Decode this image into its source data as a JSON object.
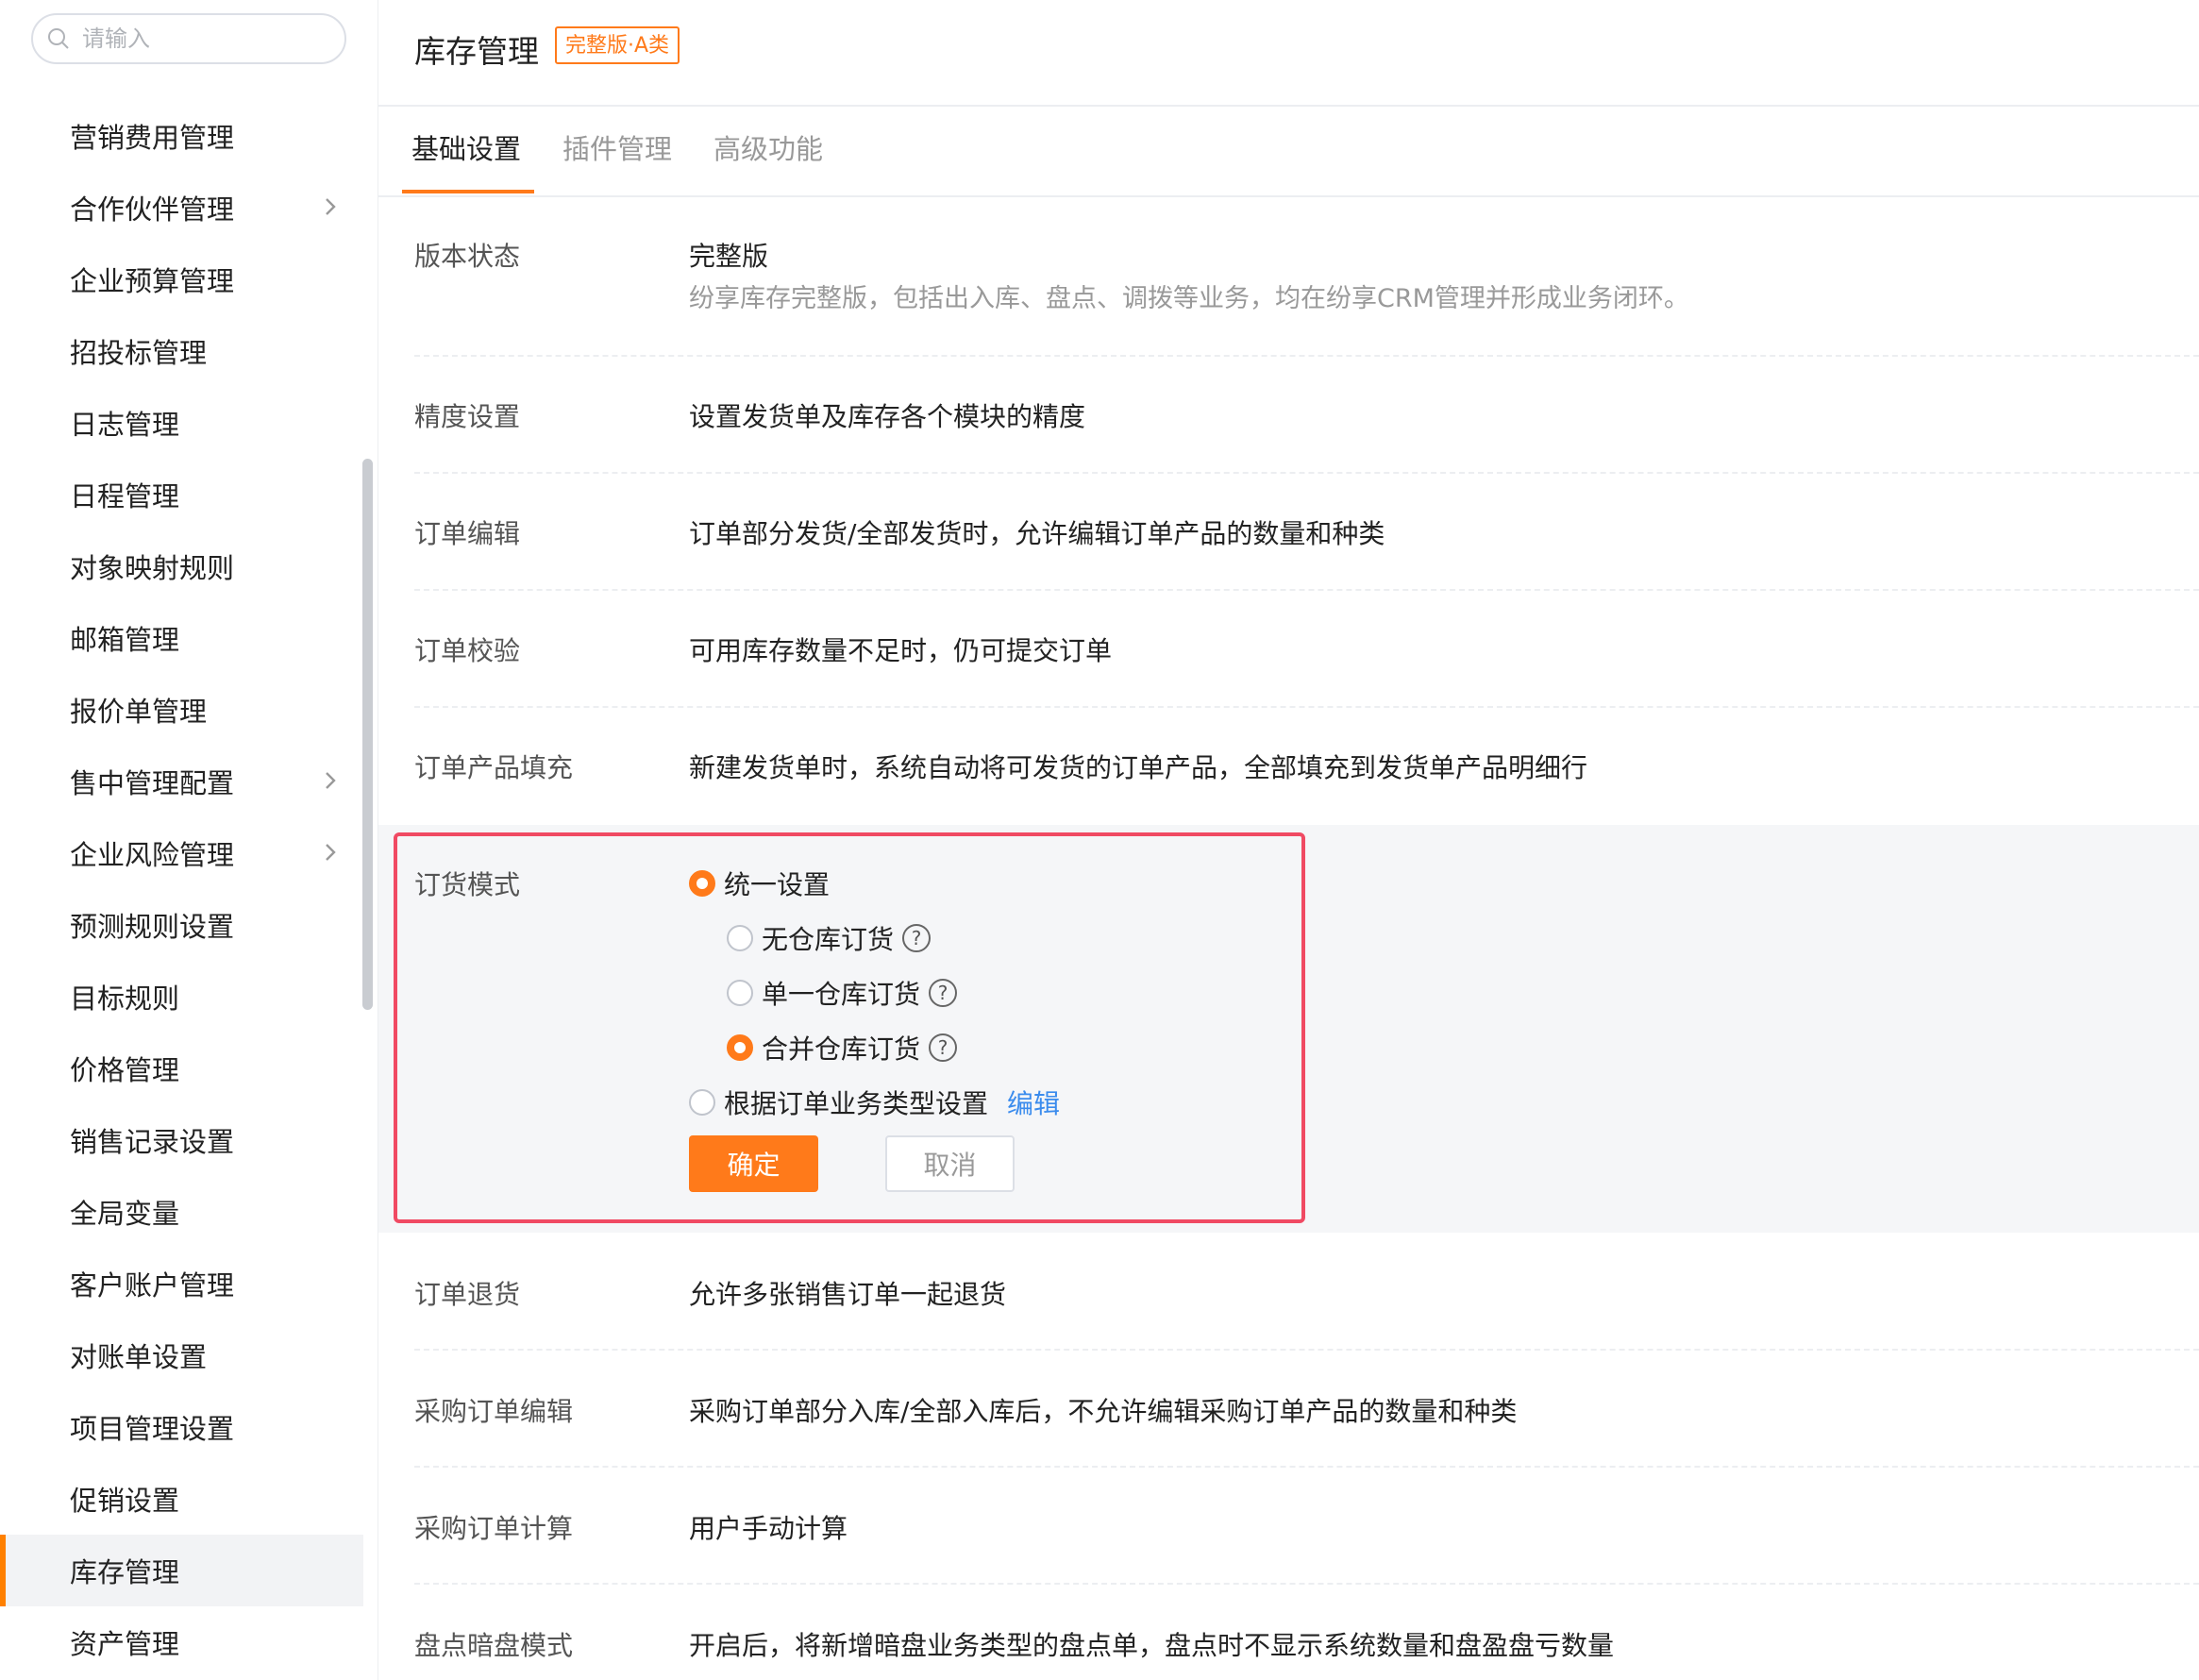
{
  "search": {
    "placeholder": "请输入"
  },
  "sidebar": {
    "items": [
      {
        "label": "营销费用管理"
      },
      {
        "label": "合作伙伴管理"
      },
      {
        "label": "企业预算管理"
      },
      {
        "label": "招投标管理"
      },
      {
        "label": "日志管理"
      },
      {
        "label": "日程管理"
      },
      {
        "label": "对象映射规则"
      },
      {
        "label": "邮箱管理"
      },
      {
        "label": "报价单管理"
      },
      {
        "label": "售中管理配置"
      },
      {
        "label": "企业风险管理"
      },
      {
        "label": "预测规则设置"
      },
      {
        "label": "目标规则"
      },
      {
        "label": "价格管理"
      },
      {
        "label": "销售记录设置"
      },
      {
        "label": "全局变量"
      },
      {
        "label": "客户账户管理"
      },
      {
        "label": "对账单设置"
      },
      {
        "label": "项目管理设置"
      },
      {
        "label": "促销设置"
      },
      {
        "label": "库存管理"
      },
      {
        "label": "资产管理"
      }
    ],
    "active_item": "库存管理"
  },
  "header": {
    "title": "库存管理",
    "badge": "完整版·A类"
  },
  "tabs": [
    {
      "label": "基础设置"
    },
    {
      "label": "插件管理"
    },
    {
      "label": "高级功能"
    }
  ],
  "settings": {
    "version": {
      "label": "版本状态",
      "value": "完整版",
      "desc": "纷享库存完整版，包括出入库、盘点、调拨等业务，均在纷享CRM管理并形成业务闭环。"
    },
    "precision": {
      "label": "精度设置",
      "value": "设置发货单及库存各个模块的精度"
    },
    "order_edit": {
      "label": "订单编辑",
      "value": "订单部分发货/全部发货时，允许编辑订单产品的数量和种类"
    },
    "order_check": {
      "label": "订单校验",
      "value": "可用库存数量不足时，仍可提交订单"
    },
    "order_fill": {
      "label": "订单产品填充",
      "value": "新建发货单时，系统自动将可发货的订单产品，全部填充到发货单产品明细行"
    },
    "order_mode": {
      "label": "订货模式",
      "unified": "统一设置",
      "no_warehouse": "无仓库订货",
      "single_warehouse": "单一仓库订货",
      "merged_warehouse": "合并仓库订货",
      "by_type": "根据订单业务类型设置",
      "edit_link": "编辑",
      "help_glyph": "?",
      "confirm": "确定",
      "cancel": "取消"
    },
    "order_return": {
      "label": "订单退货",
      "value": "允许多张销售订单一起退货"
    },
    "purchase_edit": {
      "label": "采购订单编辑",
      "value": "采购订单部分入库/全部入库后，不允许编辑采购订单产品的数量和种类"
    },
    "purchase_calc": {
      "label": "采购订单计算",
      "value": "用户手动计算"
    },
    "blind_count": {
      "label": "盘点暗盘模式",
      "value": "开启后，将新增暗盘业务类型的盘点单，盘点时不显示系统数量和盘盈盘亏数量"
    }
  },
  "colors": {
    "accent": "#ff7a1a",
    "highlight_border": "#f04a63",
    "link": "#3b8ced"
  }
}
